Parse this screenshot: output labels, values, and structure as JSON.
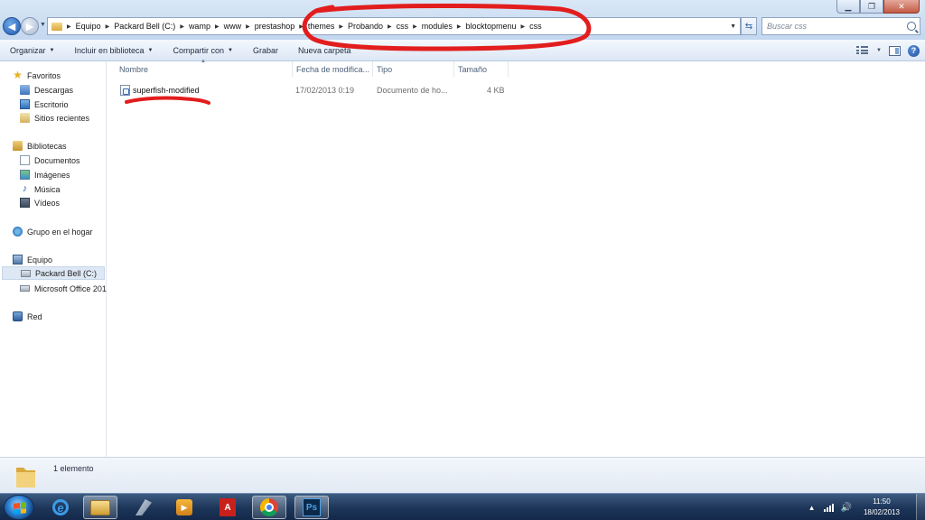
{
  "window": {
    "controls": {
      "minimize": "▁",
      "maximize": "❐",
      "close": "✕"
    }
  },
  "address_bar": {
    "breadcrumbs": [
      "Equipo",
      "Packard Bell (C:)",
      "wamp",
      "www",
      "prestashop",
      "themes",
      "Probando",
      "css",
      "modules",
      "blocktopmenu",
      "css"
    ]
  },
  "search": {
    "placeholder": "Buscar css"
  },
  "toolbar": {
    "organize": "Organizar",
    "include_library": "Incluir en biblioteca",
    "share": "Compartir con",
    "burn": "Grabar",
    "new_folder": "Nueva carpeta"
  },
  "sidebar": {
    "favorites": {
      "label": "Favoritos",
      "items": [
        "Descargas",
        "Escritorio",
        "Sitios recientes"
      ]
    },
    "libraries": {
      "label": "Bibliotecas",
      "items": [
        "Documentos",
        "Imágenes",
        "Música",
        "Vídeos"
      ]
    },
    "homegroup": {
      "label": "Grupo en el hogar"
    },
    "computer": {
      "label": "Equipo",
      "items": [
        "Packard Bell (C:)",
        "Microsoft Office 201"
      ]
    },
    "network": {
      "label": "Red"
    }
  },
  "columns": [
    "Nombre",
    "Fecha de modifica...",
    "Tipo",
    "Tamaño"
  ],
  "files": [
    {
      "name": "superfish-modified",
      "modified": "17/02/2013 0:19",
      "type": "Documento de ho...",
      "size": "4 KB"
    }
  ],
  "details": {
    "count": "1 elemento"
  },
  "taskbar": {
    "apps": [
      "internet-explorer",
      "windows-explorer",
      "wizard",
      "media-player",
      "acrobat",
      "chrome",
      "photoshop"
    ],
    "pdf_glyph": "A",
    "ps_glyph": "Ps",
    "clock_time": "11:50",
    "clock_date": "18/02/2013"
  },
  "annotation_color": "#e21d1d"
}
